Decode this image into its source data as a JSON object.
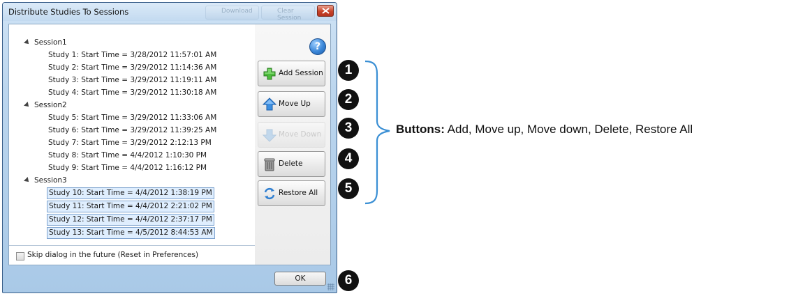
{
  "window": {
    "title": "Distribute Studies To Sessions",
    "ghost_buttons": [
      "Download",
      "Clear Session"
    ]
  },
  "tree": {
    "sessions": [
      {
        "label": "Session1",
        "studies": [
          "Study 1: Start Time = 3/28/2012 11:57:01 AM",
          "Study 2: Start Time = 3/29/2012 11:14:36 AM",
          "Study 3: Start Time = 3/29/2012 11:19:11 AM",
          "Study 4: Start Time = 3/29/2012 11:30:18 AM"
        ]
      },
      {
        "label": "Session2",
        "studies": [
          "Study 5: Start Time = 3/29/2012 11:33:06 AM",
          "Study 6: Start Time = 3/29/2012 11:39:25 AM",
          "Study 7: Start Time = 3/29/2012 2:12:13 PM",
          "Study 8: Start Time = 4/4/2012 1:10:30 PM",
          "Study 9: Start Time = 4/4/2012 1:16:12 PM"
        ]
      },
      {
        "label": "Session3",
        "studies": [
          "Study 10: Start Time = 4/4/2012 1:38:19 PM",
          "Study 11: Start Time = 4/4/2012 2:21:02 PM",
          "Study 12: Start Time = 4/4/2012 2:37:17 PM",
          "Study 13: Start Time = 4/5/2012 8:44:53 AM"
        ]
      }
    ]
  },
  "footer": {
    "skip_label": "Skip dialog in the future (Reset in Preferences)",
    "skip_checked": false
  },
  "buttons": {
    "add_session": "Add Session",
    "move_up": "Move Up",
    "move_down": "Move Down",
    "delete": "Delete",
    "restore_all": "Restore All",
    "ok": "OK",
    "help": "?"
  },
  "callouts": {
    "numbers": [
      "1",
      "2",
      "3",
      "4",
      "5",
      "6"
    ],
    "caption_bold": "Buttons:",
    "caption_text": " Add, Move up, Move down, Delete, Restore All"
  },
  "colors": {
    "accent_blue": "#3a86d8",
    "brace": "#3a8fd4",
    "selection": "#dfeefe"
  }
}
